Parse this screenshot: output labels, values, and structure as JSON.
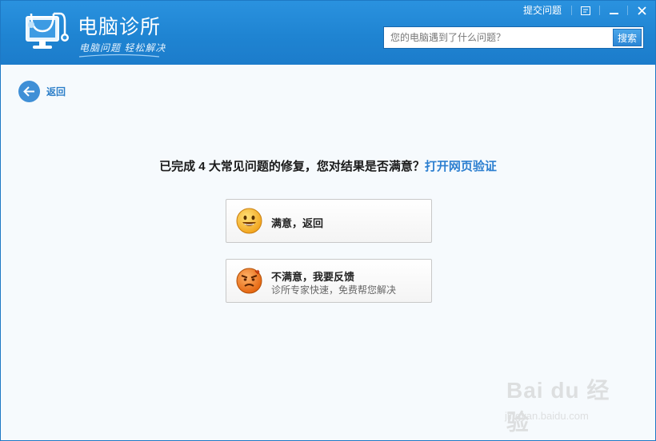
{
  "header": {
    "title": "电脑诊所",
    "slogan": "电脑问题 轻松解决",
    "help_link": "提交问题",
    "search": {
      "placeholder": "您的电脑遇到了什么问题？",
      "button_label": "搜索"
    }
  },
  "nav": {
    "back_label": "返回"
  },
  "main": {
    "question_text": "已完成 4 大常见问题的修复，您对结果是否满意？",
    "verify_link": "打开网页验证",
    "options": [
      {
        "title": "满意，返回"
      },
      {
        "title": "不满意，我要反馈",
        "subtitle": "诊所专家快速，免费帮您解决"
      }
    ]
  },
  "watermark": {
    "brand": "Bai du 经验",
    "url": "jingyan.baidu.com"
  },
  "colors": {
    "header_blue": "#1f84d2",
    "link_blue": "#2c7fd0",
    "background": "#f6fafd"
  },
  "icons": [
    "stethoscope-monitor-icon",
    "feedback-icon",
    "minimize-icon",
    "close-icon",
    "back-arrow-icon",
    "smiley-face-icon",
    "angry-face-icon"
  ]
}
